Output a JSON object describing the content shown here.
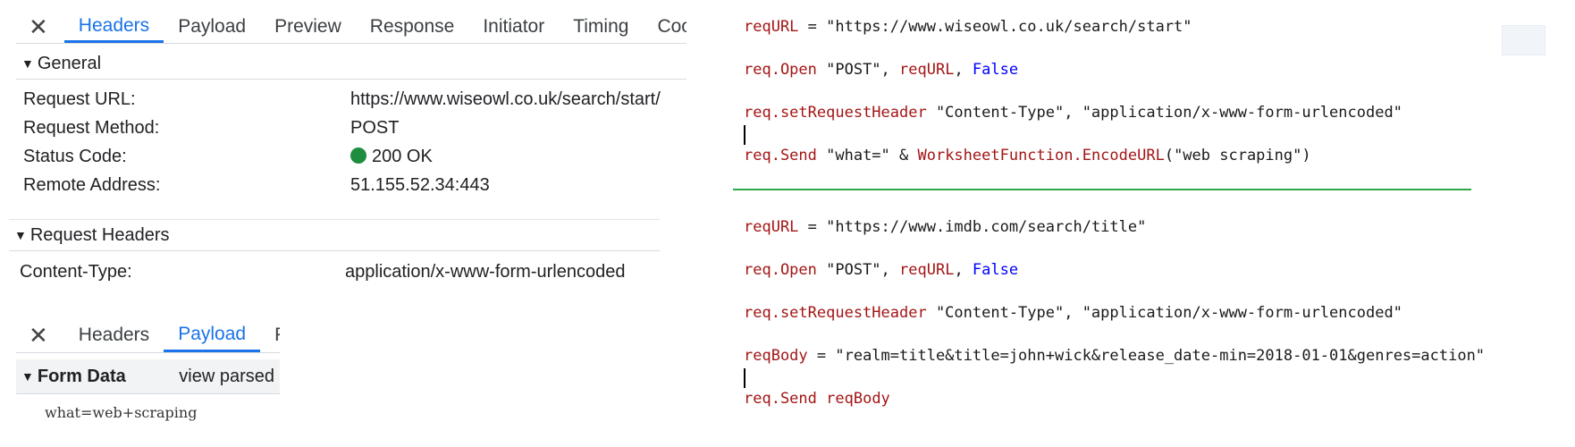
{
  "devtools1": {
    "close": "✕",
    "tabs": [
      "Headers",
      "Payload",
      "Preview",
      "Response",
      "Initiator",
      "Timing",
      "Cook"
    ],
    "general_head": "General",
    "general": [
      {
        "key": "Request URL:",
        "value": "https://www.wiseowl.co.uk/search/start/"
      },
      {
        "key": "Request Method:",
        "value": "POST"
      },
      {
        "key": "Status Code:",
        "value": "200 OK"
      },
      {
        "key": "Remote Address:",
        "value": "51.155.52.34:443"
      }
    ],
    "req_headers_head": "Request Headers",
    "req_headers": [
      {
        "key": "Content-Type:",
        "value": "application/x-www-form-urlencoded"
      }
    ],
    "status_color": "#1e8e3e",
    "accent": "#1a73e8"
  },
  "devtools2": {
    "close": "✕",
    "tabs": [
      "Headers",
      "Payload",
      "Pr"
    ],
    "form_head": "Form Data",
    "view_parsed": "view parsed",
    "form_value": "what=web+scraping"
  },
  "code_block1": {
    "line1": {
      "id": "reqURL",
      "rest": " = \"https://www.wiseowl.co.uk/search/start\""
    },
    "line2": {
      "id": "req.Open",
      "rest": " \"POST\", ",
      "id2": "reqURL",
      "sep": ", ",
      "kw": "False"
    },
    "line3": {
      "id": "req.setRequestHeader",
      "rest": " \"Content-Type\", \"application/x-www-form-urlencoded\""
    },
    "line4": {
      "id": "req.Send",
      "rest": " \"what=\" & ",
      "id2": "WorksheetFunction.EncodeURL",
      "rest2": "(\"web scraping\")"
    }
  },
  "code_block2": {
    "line1": {
      "id": "reqURL",
      "rest": " = \"https://www.imdb.com/search/title\""
    },
    "line2": {
      "id": "req.Open",
      "rest": " \"POST\", ",
      "id2": "reqURL",
      "sep": ", ",
      "kw": "False"
    },
    "line3": {
      "id": "req.setRequestHeader",
      "rest": " \"Content-Type\", \"application/x-www-form-urlencoded\""
    },
    "line4": {
      "id": "reqBody",
      "rest": " = \"realm=title&title=john+wick&release_date-min=2018-01-01&genres=action\""
    },
    "line5": {
      "id": "req.Send",
      "rest": " ",
      "id2": "reqBody"
    }
  },
  "colors": {
    "divider": "#2ea84a",
    "identifier": "#a31515",
    "keyword": "#0000ff"
  }
}
